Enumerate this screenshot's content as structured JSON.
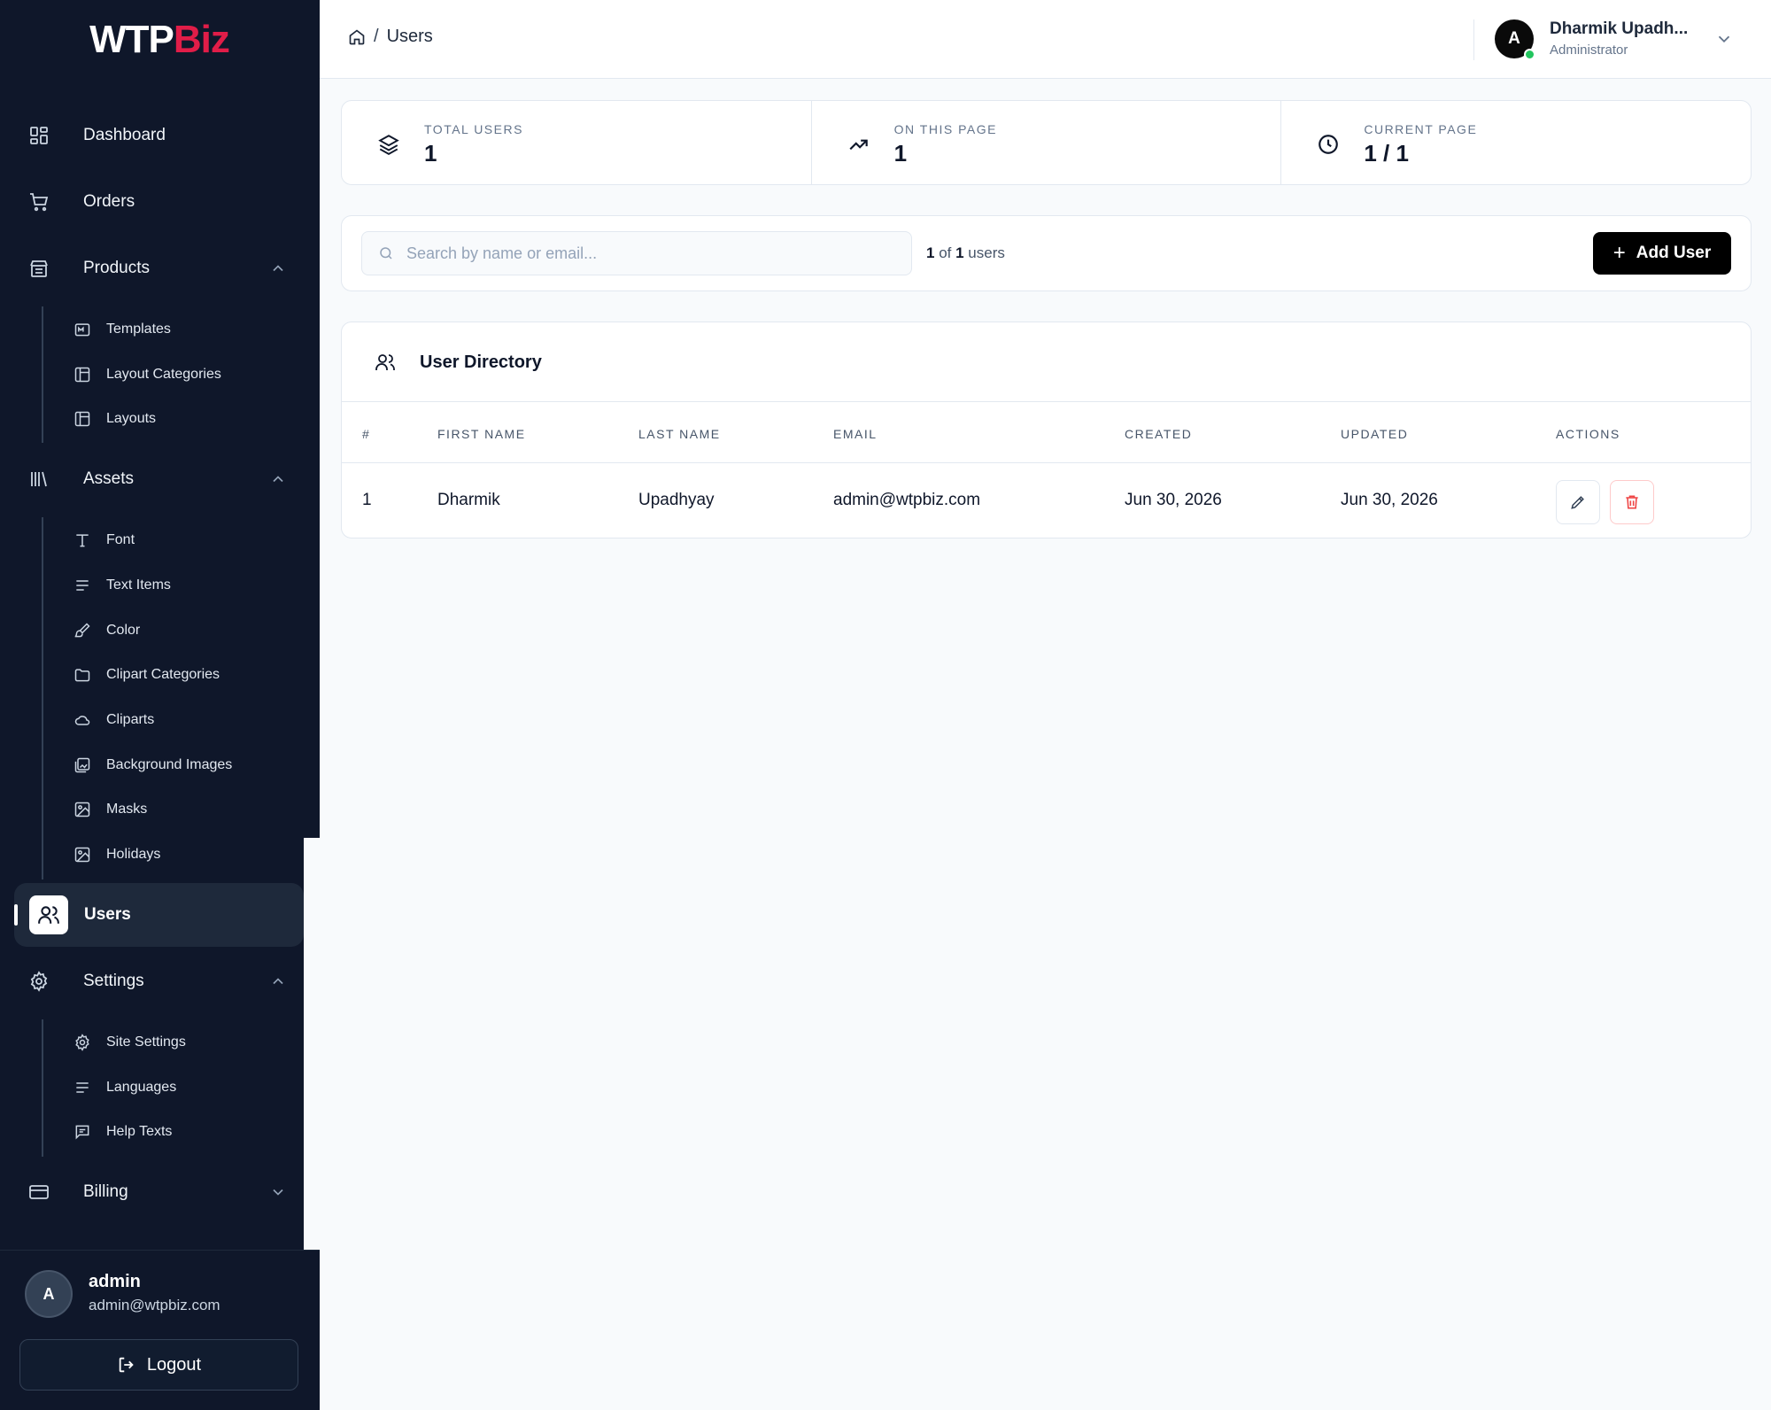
{
  "logo": {
    "part1": "WTP",
    "part2": "Biz"
  },
  "sidebar": {
    "dashboard": "Dashboard",
    "orders": "Orders",
    "products": {
      "label": "Products",
      "items": [
        "Templates",
        "Layout Categories",
        "Layouts"
      ]
    },
    "assets": {
      "label": "Assets",
      "items": [
        "Font",
        "Text Items",
        "Color",
        "Clipart Categories",
        "Cliparts",
        "Background Images",
        "Masks",
        "Holidays"
      ]
    },
    "users": "Users",
    "settings": {
      "label": "Settings",
      "items": [
        "Site Settings",
        "Languages",
        "Help Texts"
      ]
    },
    "billing": "Billing"
  },
  "footer": {
    "avatar_initial": "A",
    "name": "admin",
    "email": "admin@wtpbiz.com",
    "logout": "Logout"
  },
  "header": {
    "breadcrumb_sep": "/",
    "breadcrumb_current": "Users",
    "user_initial": "A",
    "user_name": "Dharmik Upadh...",
    "user_role": "Administrator"
  },
  "stats": [
    {
      "label": "TOTAL USERS",
      "value": "1"
    },
    {
      "label": "ON THIS PAGE",
      "value": "1"
    },
    {
      "label": "CURRENT PAGE",
      "value": "1 / 1"
    }
  ],
  "toolbar": {
    "search_placeholder": "Search by name or email...",
    "count_shown": "1",
    "count_of": " of ",
    "count_total": "1",
    "count_suffix": " users",
    "add_label": "Add User",
    "add_icon": "+"
  },
  "table": {
    "title": "User Directory",
    "columns": [
      "#",
      "FIRST NAME",
      "LAST NAME",
      "EMAIL",
      "CREATED",
      "UPDATED",
      "ACTIONS"
    ],
    "rows": [
      [
        "1",
        "Dharmik",
        "Upadhyay",
        "admin@wtpbiz.com",
        "Jun 30, 2026",
        "Jun 30, 2026"
      ]
    ]
  },
  "colors": {
    "sidebar_bg": "#0f172a",
    "brand_accent": "#e11d48",
    "online": "#22c55e",
    "danger": "#ef4444"
  }
}
